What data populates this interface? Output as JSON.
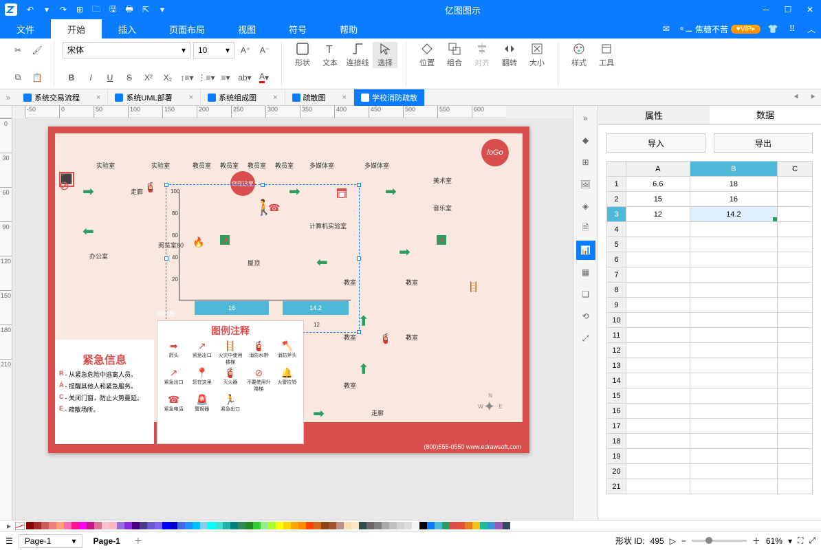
{
  "app": {
    "title": "亿图图示"
  },
  "titlebar_tools": [
    "undo",
    "redo",
    "new",
    "open",
    "save",
    "print",
    "export"
  ],
  "menu": {
    "items": [
      "文件",
      "开始",
      "插入",
      "页面布局",
      "视图",
      "符号",
      "帮助"
    ],
    "active": 1
  },
  "user": {
    "name": "焦糖不苦",
    "vip": "VIP"
  },
  "ribbon": {
    "font": "宋体",
    "size": "10",
    "shape": "形状",
    "text": "文本",
    "connector": "连接线",
    "select": "选择",
    "position": "位置",
    "group": "组合",
    "align": "对齐",
    "flip": "翻转",
    "sizebtn": "大小",
    "style": "样式",
    "tools": "工具"
  },
  "tabs": [
    {
      "label": "系统交易流程",
      "active": false
    },
    {
      "label": "系统UML部署",
      "active": false
    },
    {
      "label": "系统组成图",
      "active": false
    },
    {
      "label": "疏散图",
      "active": false
    },
    {
      "label": "学校消防疏散",
      "active": true
    }
  ],
  "hruler": [
    "-50",
    "0",
    "50",
    "100",
    "150",
    "200",
    "250",
    "300",
    "350",
    "400",
    "450",
    "500",
    "550",
    "600"
  ],
  "vruler": [
    "0",
    "30",
    "60",
    "90",
    "120",
    "150",
    "180",
    "210"
  ],
  "page": {
    "logo": "loGo",
    "rooms": [
      "实验室",
      "实验室",
      "教员室",
      "教员室",
      "教员室",
      "教员室",
      "多媒体室",
      "多媒体室",
      "美术室",
      "音乐室",
      "计算机实验室",
      "走廊",
      "阅览室80",
      "屋顶",
      "办公室",
      "疏散图",
      "教室",
      "教室",
      "教室",
      "教室",
      "教室",
      "走廊"
    ],
    "you_are_here": "您在这里",
    "legend_title": "图例注释",
    "legend_items": [
      "箭头",
      "紧急出口",
      "火灾中使用楼梯",
      "消防水带",
      "消防斧头",
      "紧急出口",
      "您在这里",
      "灭火器",
      "不要使用升降梯",
      "火警拉铃",
      "紧急电话",
      "警报器",
      "紧急出口"
    ],
    "emerg_title": "紧急信息",
    "emerg_lines": [
      {
        "k": "R",
        "t": "- 从紧急危险中逃离人员。"
      },
      {
        "k": "A",
        "t": "- 提醒其他人和紧急服务。"
      },
      {
        "k": "C",
        "t": "- 关闭门窗，防止火势蔓延。"
      },
      {
        "k": "E",
        "t": "- 疏散场所。"
      }
    ],
    "footer": "(800)555-0550 www.edrawsoft.com"
  },
  "chart_data": {
    "type": "bar",
    "categories": [
      "1",
      "2",
      "3"
    ],
    "series_labels": [
      "A",
      "B",
      "C"
    ],
    "values_a": [
      6.6,
      15,
      12
    ],
    "values_b": [
      18,
      16,
      14.2
    ],
    "bar_labels": [
      "16",
      "14.2"
    ],
    "x_tick": "12",
    "y_ticks": [
      "20",
      "40",
      "60",
      "80",
      "100"
    ]
  },
  "rightpanel": {
    "tabs": [
      "属性",
      "数据"
    ],
    "active": 1,
    "import": "导入",
    "export": "导出",
    "cols": [
      "",
      "A",
      "B",
      "C"
    ],
    "rows": [
      {
        "h": "1",
        "a": "6.6",
        "b": "18",
        "c": ""
      },
      {
        "h": "2",
        "a": "15",
        "b": "16",
        "c": ""
      },
      {
        "h": "3",
        "a": "12",
        "b": "14.2",
        "c": ""
      }
    ],
    "empty_rows": [
      "4",
      "5",
      "6",
      "7",
      "8",
      "9",
      "10",
      "11",
      "12",
      "13",
      "14",
      "15",
      "16",
      "17",
      "18",
      "19",
      "20",
      "21"
    ]
  },
  "status": {
    "pagesel": "Page-1",
    "pagetab": "Page-1",
    "shape_id_label": "形状 ID:",
    "shape_id": "495",
    "zoom": "61%"
  }
}
